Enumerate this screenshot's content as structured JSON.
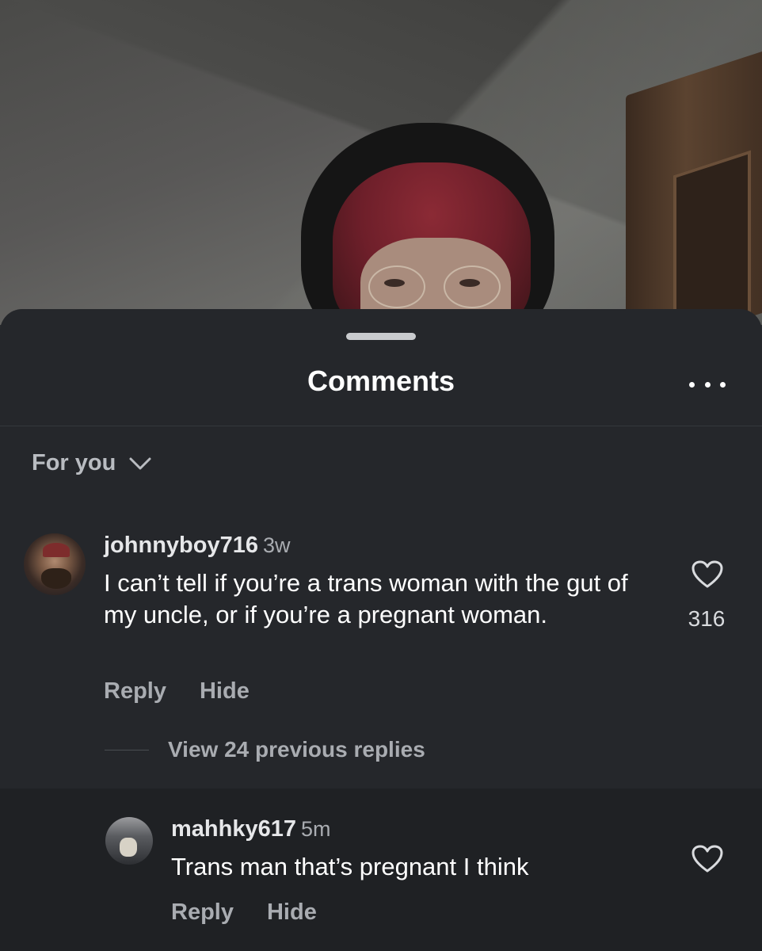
{
  "sheet": {
    "title": "Comments",
    "sort_label": "For you"
  },
  "comments": [
    {
      "username": "johnnyboy716",
      "time": "3w",
      "text": "I can’t tell if you’re a trans woman with the gut of my uncle, or if you’re a pregnant woman.",
      "likes": "316",
      "reply_label": "Reply",
      "hide_label": "Hide"
    }
  ],
  "view_replies_label": "View 24 previous replies",
  "replies": [
    {
      "username": "mahhky617",
      "time": "5m",
      "text": "Trans man that’s pregnant I think",
      "reply_label": "Reply",
      "hide_label": "Hide"
    }
  ],
  "icons": {
    "more": "ellipsis-icon",
    "sort": "chevron-down-icon",
    "like": "heart-outline-icon"
  },
  "colors": {
    "sheet_background": "#25272b",
    "reply_background": "#1f2124",
    "secondary_text": "#a9acb1"
  }
}
